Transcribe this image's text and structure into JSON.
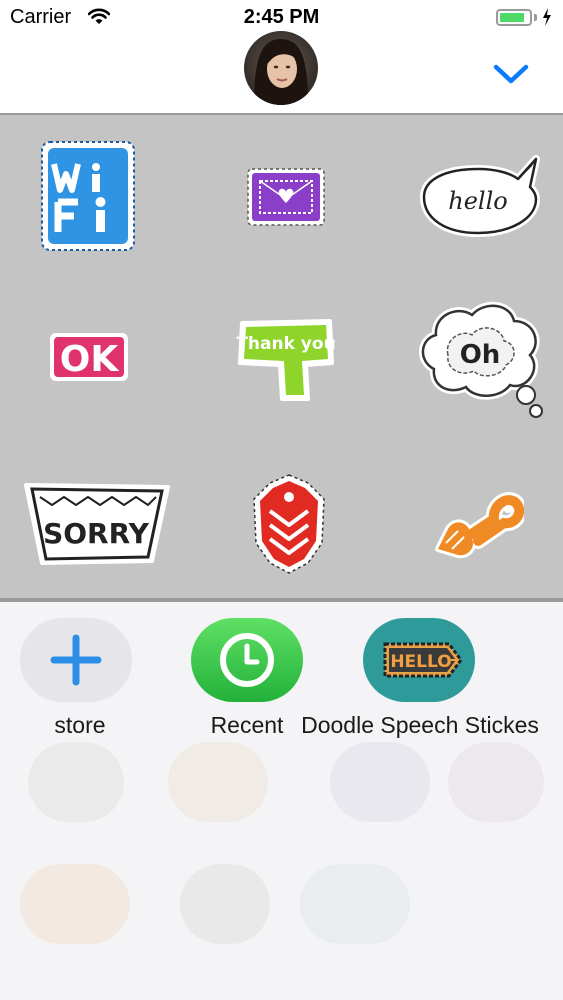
{
  "status_bar": {
    "carrier": "Carrier",
    "time": "2:45 PM",
    "battery_level": 0.85
  },
  "header": {
    "avatar_icon": "contact-photo",
    "collapse_icon": "chevron-down-icon",
    "accent_color": "#0a7bff"
  },
  "stickers": [
    {
      "name": "wifi-sticker",
      "text": "WiFi",
      "color": "#2f94e3"
    },
    {
      "name": "heart-envelope-sticker",
      "text": "",
      "color": "#8b3fc8"
    },
    {
      "name": "hello-bubble-sticker",
      "text": "hello",
      "color": "#ffffff"
    },
    {
      "name": "ok-sticker",
      "text": "OK",
      "color": "#e0336c"
    },
    {
      "name": "thank-you-sticker",
      "text": "Thank you",
      "color": "#8ed42a"
    },
    {
      "name": "oh-cloud-sticker",
      "text": "Oh",
      "color": "#ffffff"
    },
    {
      "name": "sorry-sticker",
      "text": "SORRY",
      "color": "#ffffff"
    },
    {
      "name": "chevrons-sticker",
      "text": "",
      "color": "#e02a22"
    },
    {
      "name": "key-sticker",
      "text": "",
      "color": "#f08a24"
    }
  ],
  "apps": [
    {
      "label": "store",
      "icon": "plus-icon"
    },
    {
      "label": "Recent",
      "icon": "clock-icon"
    },
    {
      "label": "Doodle Speech Stickes",
      "icon": "hello-sign-icon"
    }
  ]
}
